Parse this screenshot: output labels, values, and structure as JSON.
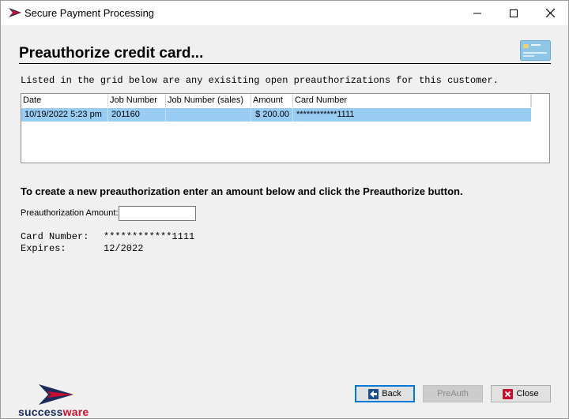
{
  "window": {
    "title": "Secure Payment Processing"
  },
  "heading": "Preauthorize credit card...",
  "intro_text": "Listed in the grid below are any exisiting open preauthorizations for this customer.",
  "grid": {
    "columns": [
      "Date",
      "Job Number",
      "Job Number (sales)",
      "Amount",
      "Card Number"
    ],
    "rows": [
      {
        "date": "10/19/2022  5:23 pm",
        "job_number": "201160",
        "job_number_sales": "",
        "amount": "$ 200.00",
        "card_number": "************1111"
      }
    ]
  },
  "instructions": "To create a new preauthorization enter an amount below and click the Preauthorize button.",
  "amount_field": {
    "label": "Preauthorization Amount:",
    "value": ""
  },
  "card_info": {
    "card_number_label": "Card Number:",
    "card_number": "************1111",
    "expires_label": "Expires:",
    "expires": "12/2022"
  },
  "logo": {
    "part1": "success",
    "part2": "ware"
  },
  "buttons": {
    "back": "Back",
    "preauth": "PreAuth",
    "close": "Close"
  },
  "colors": {
    "selection": "#99ccf2",
    "focus_border": "#0078d7",
    "brand_red": "#c8102e",
    "brand_navy": "#1a2b5e"
  }
}
